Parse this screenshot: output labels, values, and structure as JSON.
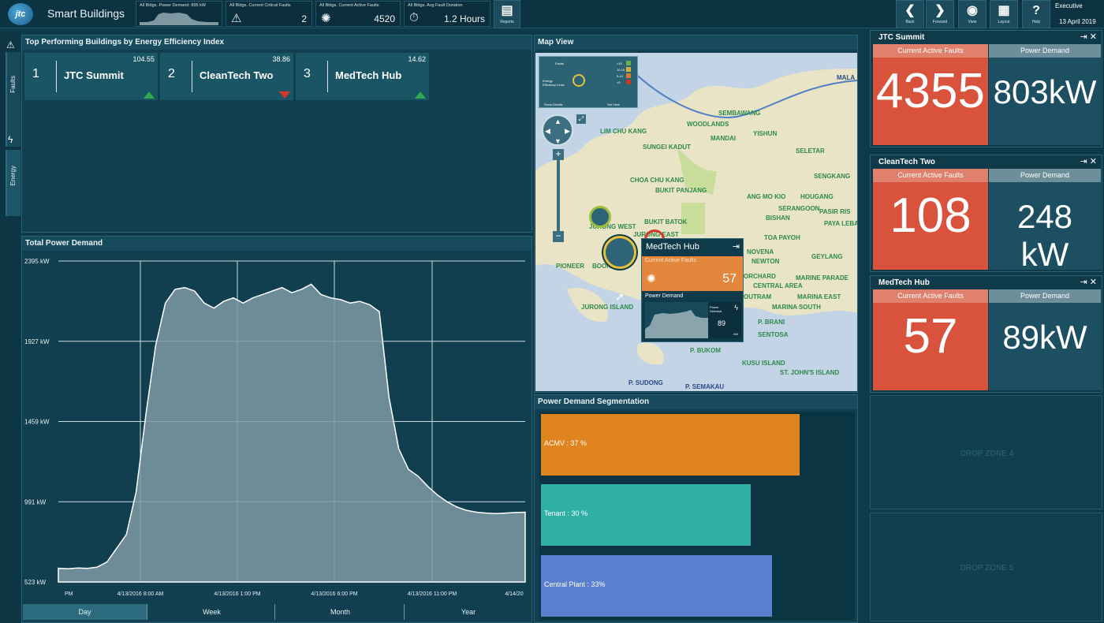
{
  "app": {
    "logo": "jtc",
    "title": "Smart Buildings"
  },
  "kpis": [
    {
      "label": "All Bldgs. Power Demand: 895 kW",
      "value": ""
    },
    {
      "label": "All Bldgs. Current Critical Faults",
      "value": "2",
      "icon": "warning-icon"
    },
    {
      "label": "All Bldgs. Current Active Faults",
      "value": "4520",
      "icon": "alarm-icon"
    },
    {
      "label": "All Bldgs. Avg Fault Duration",
      "value": "1.2 Hours",
      "icon": "timer-icon"
    }
  ],
  "reports_label": "Reports",
  "nav": {
    "back": "Back",
    "forward": "Forward",
    "view": "View",
    "layout": "Layout",
    "help": "Help"
  },
  "user": {
    "role": "Executive",
    "date": "13 April 2019"
  },
  "rail": {
    "faults": "Faults",
    "energy": "Energy"
  },
  "top_performing": {
    "title": "Top Performing Buildings by Energy Efficiency Index",
    "items": [
      {
        "rank": "1",
        "name": "JTC Summit",
        "score": "104.55",
        "trend": "up"
      },
      {
        "rank": "2",
        "name": "CleanTech Two",
        "score": "38.86",
        "trend": "down"
      },
      {
        "rank": "3",
        "name": "MedTech Hub",
        "score": "14.62",
        "trend": "up"
      }
    ]
  },
  "power_chart": {
    "title": "Total Power Demand",
    "tabs": [
      "Day",
      "Week",
      "Month",
      "Year"
    ],
    "active_tab": "Day"
  },
  "chart_data": {
    "type": "area",
    "title": "Total Power Demand",
    "y_ticks": [
      "2395 kW",
      "1927 kW",
      "1459 kW",
      "991 kW",
      "523 kW"
    ],
    "ylim": [
      523,
      2395
    ],
    "x_ticks": [
      "PM",
      "4/13/2016 8:00 AM",
      "4/13/2016 1:00 PM",
      "4/13/2016 6:00 PM",
      "4/13/2016 11:00 PM",
      "4/14/20"
    ],
    "values": [
      603,
      600,
      605,
      602,
      610,
      640,
      720,
      800,
      1050,
      1500,
      1900,
      2150,
      2230,
      2240,
      2220,
      2150,
      2120,
      2160,
      2180,
      2150,
      2180,
      2200,
      2220,
      2240,
      2210,
      2230,
      2260,
      2200,
      2180,
      2170,
      2150,
      2160,
      2140,
      2100,
      1600,
      1300,
      1180,
      1140,
      1080,
      1030,
      990,
      960,
      940,
      930,
      925,
      922,
      925,
      928,
      930
    ]
  },
  "map": {
    "title": "Map View",
    "legend": {
      "title": "Faults",
      "index_label": "Energy Efficiency Index",
      "rows": [
        ">15",
        "10-15",
        "5-10",
        "<5"
      ],
      "show_details": "Show Details",
      "set_view": "Set View"
    },
    "places": [
      "SEMBAWANG",
      "WOODLANDS",
      "LIM CHU KANG",
      "MANDAI",
      "YISHUN",
      "SELETAR",
      "SENGKANG",
      "SUNGEI KADUT",
      "CHOA CHU KANG",
      "BUKIT PANJANG",
      "ANG MO KIO",
      "HOUGANG",
      "SERANGOON",
      "BISHAN",
      "PASIR RIS",
      "PAYA LEBA",
      "BUKIT BATOK",
      "JURONG WEST",
      "JURONG EAST",
      "TOA PAYOH",
      "PIONEER",
      "BOON LAY",
      "NOVENA",
      "NEWTON",
      "GEYLANG",
      "ORCHARD",
      "MARINE PARADE",
      "CENTRAL AREA",
      "OUTRAM",
      "MARINA EAST",
      "JURONG ISLAND",
      "MARINA SOUTH",
      "P. BRANI",
      "SENTOSA",
      "P. BUKOM",
      "KUSU ISLAND",
      "ST. JOHN'S ISLAND",
      "P. SUDONG",
      "P. SEMAKAU",
      "MALA"
    ],
    "popup": {
      "title": "MedTech Hub",
      "faults_label": "Current Active Faults",
      "faults_value": "57",
      "power_label": "Power Demand",
      "power_sub": "Power Demand",
      "power_value": "89",
      "power_unit": "kW"
    }
  },
  "segmentation": {
    "title": "Power Demand Segmentation",
    "bars": [
      {
        "label": "ACMV : 37 %",
        "value": 37,
        "color": "#e0841f"
      },
      {
        "label": "Tenant : 30 %",
        "value": 30,
        "color": "#2fb0a6"
      },
      {
        "label": "Central Plant : 33%",
        "value": 33,
        "color": "#5b7fcf"
      }
    ]
  },
  "cards": [
    {
      "title": "JTC Summit",
      "faults_label": "Current Active Faults",
      "faults": "4355",
      "power_label": "Power Demand",
      "power": "803kW"
    },
    {
      "title": "CleanTech Two",
      "faults_label": "Current Active Faults",
      "faults": "108",
      "power_label": "Power Demand",
      "power": "248 kW"
    },
    {
      "title": "MedTech Hub",
      "faults_label": "Current Active Faults",
      "faults": "57",
      "power_label": "Power Demand",
      "power": "89kW"
    }
  ],
  "dropzones": [
    "DROP ZONE 4",
    "DROP ZONE 5"
  ]
}
